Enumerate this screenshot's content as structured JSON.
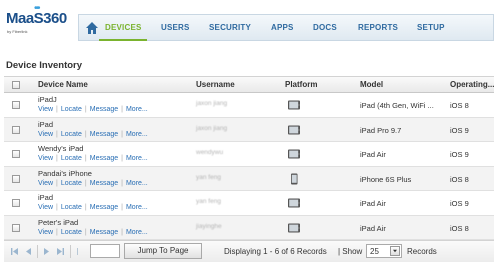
{
  "brand": {
    "logo_text": "MaaS360",
    "logo_sub": "by Fiberlink"
  },
  "nav": {
    "items": [
      {
        "label": "DEVICES",
        "active": true
      },
      {
        "label": "USERS"
      },
      {
        "label": "SECURITY"
      },
      {
        "label": "APPS"
      },
      {
        "label": "DOCS"
      },
      {
        "label": "REPORTS"
      },
      {
        "label": "SETUP"
      }
    ],
    "home_icon": "home-icon"
  },
  "page_title": "Device Inventory",
  "table": {
    "columns": [
      "Device Name",
      "Username",
      "Platform",
      "Model",
      "Operating..."
    ],
    "link_labels": [
      "View",
      "Locate",
      "Message",
      "More..."
    ],
    "rows": [
      {
        "name": "iPadJ",
        "username": "jaxon jiang",
        "platform": "tablet",
        "model": "iPad (4th Gen, WiFi ...",
        "os": "iOS 8"
      },
      {
        "name": "iPad",
        "username": "jaxon jiang",
        "platform": "tablet",
        "model": "iPad Pro 9.7",
        "os": "iOS 9"
      },
      {
        "name": "Wendy's iPad",
        "username": "wendywu",
        "platform": "tablet",
        "model": "iPad Air",
        "os": "iOS 9"
      },
      {
        "name": "Pandai's iPhone",
        "username": "yan feng",
        "platform": "phone",
        "model": "iPhone 6S Plus",
        "os": "iOS 8"
      },
      {
        "name": "iPad",
        "username": "yan feng",
        "platform": "tablet",
        "model": "iPad Air",
        "os": "iOS 9"
      },
      {
        "name": "Peter's iPad",
        "username": "jiayinghe",
        "platform": "tablet",
        "model": "iPad Air",
        "os": "iOS 8"
      }
    ]
  },
  "pager": {
    "jump_label": "Jump To Page",
    "status": "Displaying 1 - 6 of 6 Records",
    "show_label": "| Show",
    "page_size": "25",
    "records_label": "Records"
  },
  "colors": {
    "accent": "#7ab32e",
    "link": "#2a6fb5",
    "nav_text": "#2f6aa0"
  }
}
